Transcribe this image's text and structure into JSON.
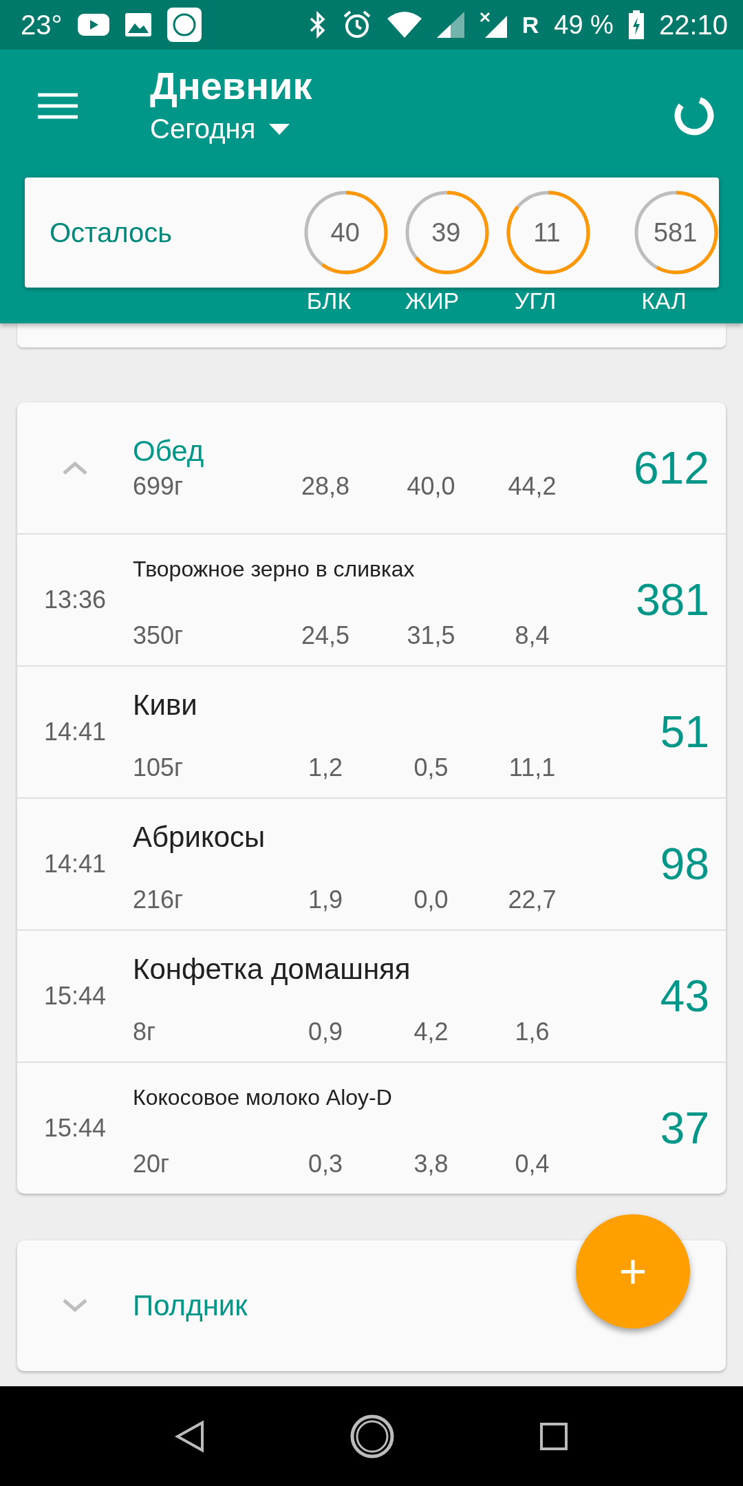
{
  "status_bar": {
    "temperature": "23°",
    "carrier_letter": "R",
    "battery": "49 %",
    "time": "22:10"
  },
  "app_bar": {
    "title": "Дневник",
    "period": "Сегодня"
  },
  "remaining": {
    "label": "Осталось",
    "rings": [
      {
        "value": "40",
        "label": "БЛК"
      },
      {
        "value": "39",
        "label": "ЖИР"
      },
      {
        "value": "11",
        "label": "УГЛ"
      },
      {
        "value": "581",
        "label": "КАЛ"
      }
    ]
  },
  "meals": [
    {
      "name": "Обед",
      "expanded": true,
      "weight": "699г",
      "protein": "28,8",
      "fat": "40,0",
      "carbs": "44,2",
      "calories": "612",
      "items": [
        {
          "time": "13:36",
          "name": "Творожное зерно в сливках",
          "weight": "350г",
          "protein": "24,5",
          "fat": "31,5",
          "carbs": "8,4",
          "calories": "381"
        },
        {
          "time": "14:41",
          "name": "Киви",
          "weight": "105г",
          "protein": "1,2",
          "fat": "0,5",
          "carbs": "11,1",
          "calories": "51"
        },
        {
          "time": "14:41",
          "name": "Абрикосы",
          "weight": "216г",
          "protein": "1,9",
          "fat": "0,0",
          "carbs": "22,7",
          "calories": "98"
        },
        {
          "time": "15:44",
          "name": "Конфетка домашняя",
          "weight": "8г",
          "protein": "0,9",
          "fat": "4,2",
          "carbs": "1,6",
          "calories": "43"
        },
        {
          "time": "15:44",
          "name": "Кокосовое молоко Aloy-D",
          "weight": "20г",
          "protein": "0,3",
          "fat": "3,8",
          "carbs": "0,4",
          "calories": "37"
        }
      ]
    },
    {
      "name": "Полдник",
      "expanded": false
    }
  ],
  "fab": {
    "label": "+"
  }
}
